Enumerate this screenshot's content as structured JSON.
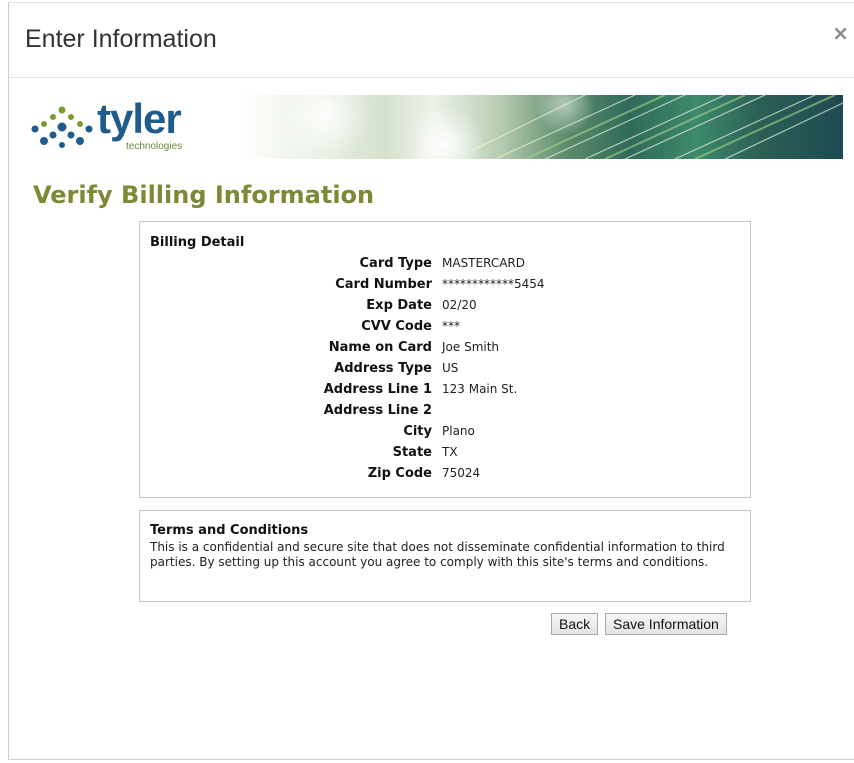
{
  "dialog": {
    "title": "Enter Information",
    "close_label": "×"
  },
  "brand": {
    "name": "tyler",
    "tagline": "technologies",
    "primary_color": "#1f5c8c",
    "accent_color": "#7a8a35"
  },
  "page": {
    "heading": "Verify Billing Information"
  },
  "billing": {
    "title": "Billing Detail",
    "fields": [
      {
        "label": "Card Type",
        "value": "MASTERCARD"
      },
      {
        "label": "Card Number",
        "value": "************5454"
      },
      {
        "label": "Exp Date",
        "value": "02/20"
      },
      {
        "label": "CVV Code",
        "value": "***"
      },
      {
        "label": "Name on Card",
        "value": "Joe Smith"
      },
      {
        "label": "Address Type",
        "value": "US"
      },
      {
        "label": "Address Line 1",
        "value": "123 Main St."
      },
      {
        "label": "Address Line 2",
        "value": ""
      },
      {
        "label": "City",
        "value": "Plano"
      },
      {
        "label": "State",
        "value": "TX"
      },
      {
        "label": "Zip Code",
        "value": "75024"
      }
    ]
  },
  "terms": {
    "title": "Terms and Conditions",
    "text": "This is a confidential and secure site that does not disseminate confidential information to third parties. By setting up this account you agree to comply with this site's terms and conditions."
  },
  "actions": {
    "back_label": "Back",
    "save_label": "Save Information"
  }
}
